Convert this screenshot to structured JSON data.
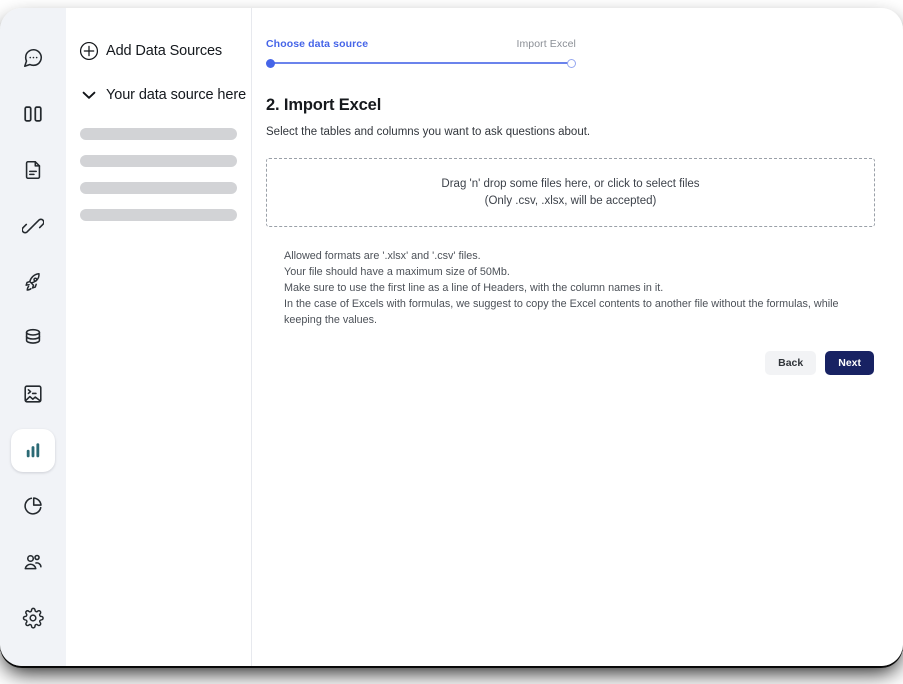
{
  "rail": {
    "items": [
      {
        "name": "chat-icon",
        "label": "Chat",
        "active": false
      },
      {
        "name": "dashboard-icon",
        "label": "Dashboards",
        "active": false
      },
      {
        "name": "document-icon",
        "label": "Documents",
        "active": false
      },
      {
        "name": "connection-icon",
        "label": "Connections",
        "active": false
      },
      {
        "name": "rocket-icon",
        "label": "Launch",
        "active": false
      },
      {
        "name": "database-icon",
        "label": "Data Sources",
        "active": false
      },
      {
        "name": "image-terminal-icon",
        "label": "Notebooks",
        "active": false
      },
      {
        "name": "bar-chart-icon",
        "label": "Charts",
        "active": true
      },
      {
        "name": "pie-chart-icon",
        "label": "Reports",
        "active": false
      },
      {
        "name": "users-icon",
        "label": "Users",
        "active": false
      },
      {
        "name": "settings-icon",
        "label": "Settings",
        "active": false
      }
    ],
    "active_accent": "#2b6a75"
  },
  "source_panel": {
    "add_label": "Add Data Sources",
    "source_label": "Your data source here",
    "skeleton_widths": [
      "100%",
      "100%",
      "100%",
      "100%"
    ]
  },
  "stepper": {
    "steps": [
      {
        "label": "Choose data source",
        "state": "done"
      },
      {
        "label": "Import Excel",
        "state": "todo"
      }
    ],
    "active_color": "#4665e8",
    "inactive_color": "#8b8f96"
  },
  "main": {
    "title": "2. Import Excel",
    "subtitle": "Select the tables and columns you want to ask questions about.",
    "dropzone": {
      "primary": "Drag 'n' drop some files here, or click to select files",
      "secondary": "(Only .csv, .xlsx, will be accepted)"
    },
    "notes": [
      "Allowed formats are '.xlsx' and '.csv' files.",
      "Your file should have a maximum size of 50Mb.",
      "Make sure to use the first line as a line of Headers, with the column names in it.",
      "In the case of Excels with formulas, we suggest to copy the Excel contents to another file without the formulas, while keeping the values."
    ],
    "actions": {
      "back_label": "Back",
      "next_label": "Next",
      "next_color": "#182263",
      "back_color": "#f2f3f5"
    }
  }
}
